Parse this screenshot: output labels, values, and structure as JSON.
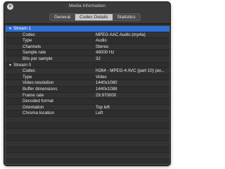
{
  "window": {
    "title": "Media Information",
    "close_glyph": "×"
  },
  "tabs": [
    "General",
    "Codec Details",
    "Statistics"
  ],
  "active_tab": "Codec Details",
  "rows": [
    {
      "type": "group",
      "label": "Stream 1",
      "selected": true
    },
    {
      "key": "Codec",
      "value": "MPEG AAC Audio (mp4a)"
    },
    {
      "key": "Type",
      "value": "Audio"
    },
    {
      "key": "Channels",
      "value": "Stereo"
    },
    {
      "key": "Sample rate",
      "value": "48000 Hz"
    },
    {
      "key": "Bits per sample",
      "value": "32"
    },
    {
      "type": "group",
      "label": "Stream 0"
    },
    {
      "key": "Codec",
      "value": "H264 - MPEG-4 AVC (part 10) (av..."
    },
    {
      "key": "Type",
      "value": "Video"
    },
    {
      "key": "Video resolution",
      "value": "1440x1080"
    },
    {
      "key": "Buffer dimensions",
      "value": "1440x1088"
    },
    {
      "key": "Frame rate",
      "value": "29.970000"
    },
    {
      "key": "Decoded format",
      "value": ""
    },
    {
      "key": "Orientation",
      "value": "Top left"
    },
    {
      "key": "Chroma location",
      "value": "Left"
    }
  ],
  "colors": {
    "selection": "#2f6fd6",
    "background": "#2b2b2b"
  }
}
